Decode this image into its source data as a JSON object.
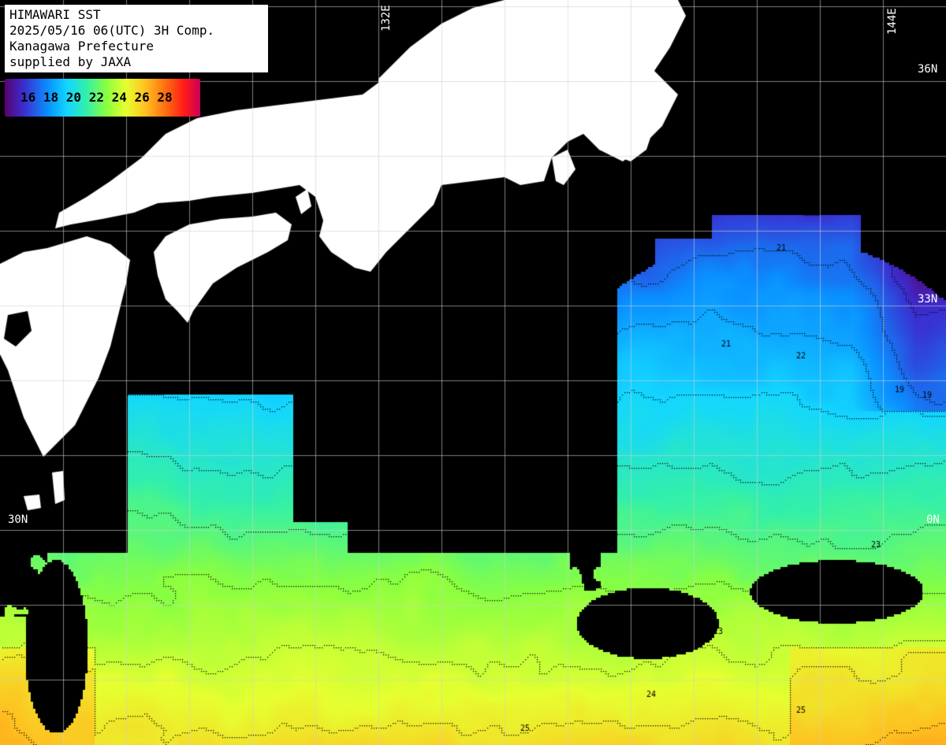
{
  "title": {
    "line1": "HIMAWARI SST",
    "line2": "2025/05/16 06(UTC) 3H Comp.",
    "line3": "Kanagawa Prefecture",
    "line4": "supplied by JAXA"
  },
  "legend": {
    "labels": "16 18 20 22 24 26 28",
    "min": 15,
    "max": 29
  },
  "grid_labels": {
    "lat36": "36N",
    "lat33": "33N",
    "lat33_left": "33",
    "lat30": "30N",
    "lat30_right": "0N",
    "lon132": "132E",
    "lon144": "144E"
  },
  "contour_labels": [
    "21",
    "21",
    "22",
    "23",
    "23",
    "24",
    "24",
    "25",
    "25",
    "19",
    "19"
  ],
  "colors": {
    "land": "#ffffff",
    "no_data": "#000000",
    "grid": "#d0d0d0",
    "contour": "#000000"
  }
}
